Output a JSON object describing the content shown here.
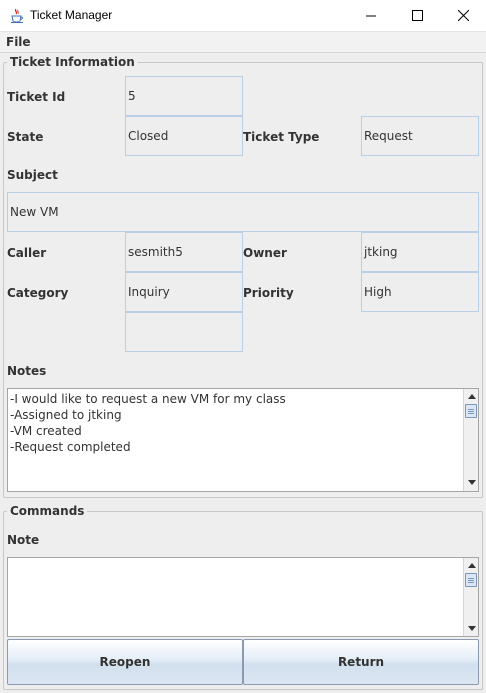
{
  "window": {
    "title": "Ticket Manager"
  },
  "menu": {
    "file": "File"
  },
  "info": {
    "legend": "Ticket Information",
    "ticket_id_label": "Ticket Id",
    "ticket_id": "5",
    "state_label": "State",
    "state": "Closed",
    "type_label": "Ticket Type",
    "type": "Request",
    "subject_label": "Subject",
    "subject": "New VM",
    "caller_label": "Caller",
    "caller": "sesmith5",
    "owner_label": "Owner",
    "owner": "jtking",
    "category_label": "Category",
    "category": "Inquiry",
    "priority_label": "Priority",
    "priority": "High",
    "extra": "",
    "notes_label": "Notes",
    "notes": "-I would like to request a new VM for my class\n-Assigned to jtking\n-VM created\n-Request completed"
  },
  "commands": {
    "legend": "Commands",
    "note_label": "Note",
    "note": "",
    "reopen": "Reopen",
    "return": "Return"
  },
  "icons": {
    "app": "java-coffee-cup-icon",
    "minimize": "minimize-icon",
    "maximize": "maximize-icon",
    "close": "close-icon"
  },
  "colors": {
    "field_border": "#b8cfe5",
    "background": "#eeeeee",
    "button_border": "#8c9ab0"
  }
}
